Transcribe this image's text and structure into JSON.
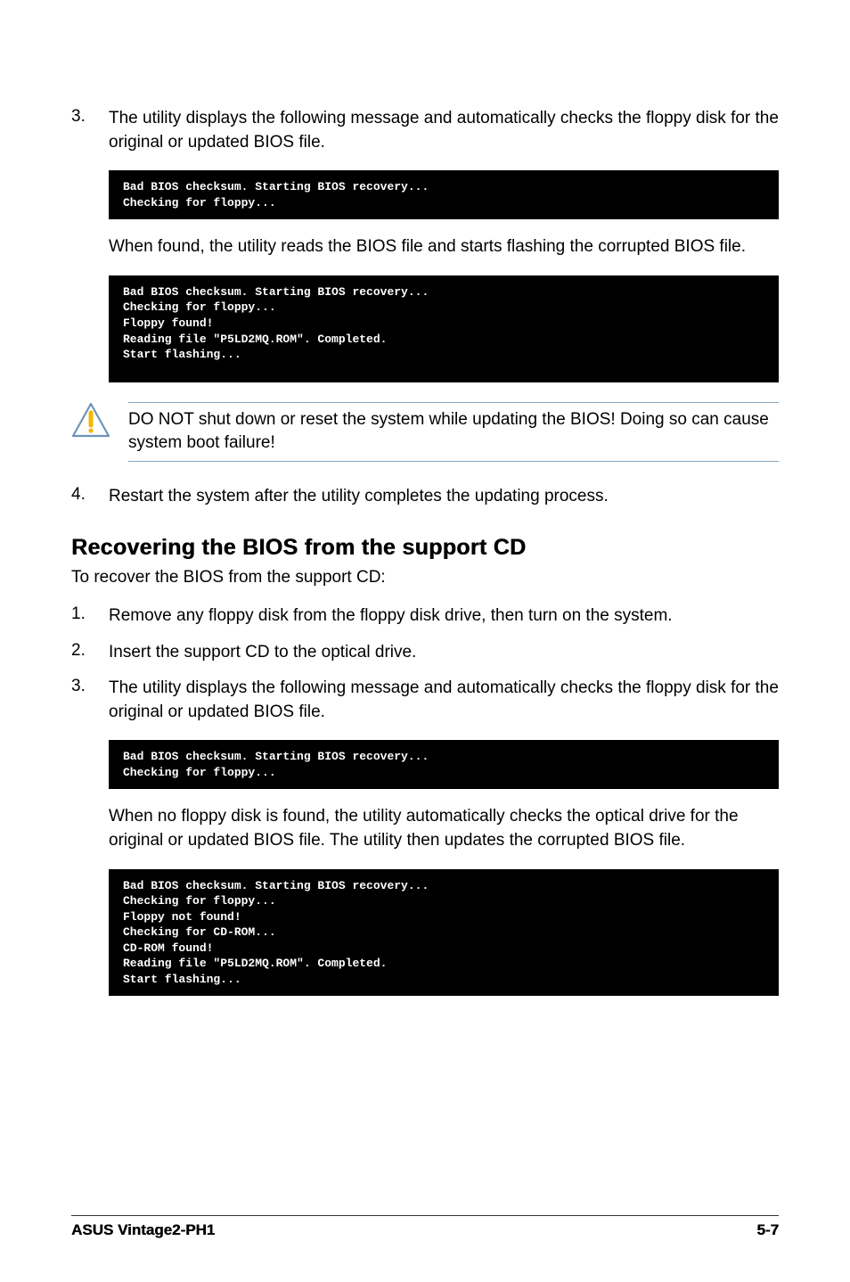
{
  "steps_a": {
    "num3": "3.",
    "text3": "The utility displays the following message and automatically checks the floppy disk for the original or updated BIOS file."
  },
  "term1": "Bad BIOS checksum. Starting BIOS recovery...\nChecking for floppy...",
  "found_para": "When found, the utility reads the BIOS file and starts flashing the corrupted BIOS file.",
  "term2": "Bad BIOS checksum. Starting BIOS recovery...\nChecking for floppy...\nFloppy found!\nReading file \"P5LD2MQ.ROM\". Completed.\nStart flashing...",
  "warning": "DO NOT shut down or reset the system while updating the BIOS! Doing so can cause system boot failure!",
  "steps_b": {
    "num4": "4.",
    "text4": "Restart the system after the utility completes the updating process."
  },
  "heading": "Recovering the BIOS from the support CD",
  "intro": "To recover the BIOS from the support CD:",
  "cd_steps": {
    "n1": "1.",
    "t1": "Remove any floppy disk from the floppy disk drive, then turn on the system.",
    "n2": "2.",
    "t2": "Insert the support CD to the optical drive.",
    "n3": "3.",
    "t3": "The utility displays the following message and automatically checks the floppy disk for the original or updated BIOS file."
  },
  "term3": "Bad BIOS checksum. Starting BIOS recovery...\nChecking for floppy...",
  "nofloppy_para": "When no floppy disk is found, the utility automatically checks the optical drive for the original or updated BIOS file. The utility then updates the corrupted BIOS file.",
  "term4": "Bad BIOS checksum. Starting BIOS recovery...\nChecking for floppy...\nFloppy not found!\nChecking for CD-ROM...\nCD-ROM found!\nReading file \"P5LD2MQ.ROM\". Completed.\nStart flashing...",
  "footer": {
    "left": "ASUS Vintage2-PH1",
    "right": "5-7"
  }
}
